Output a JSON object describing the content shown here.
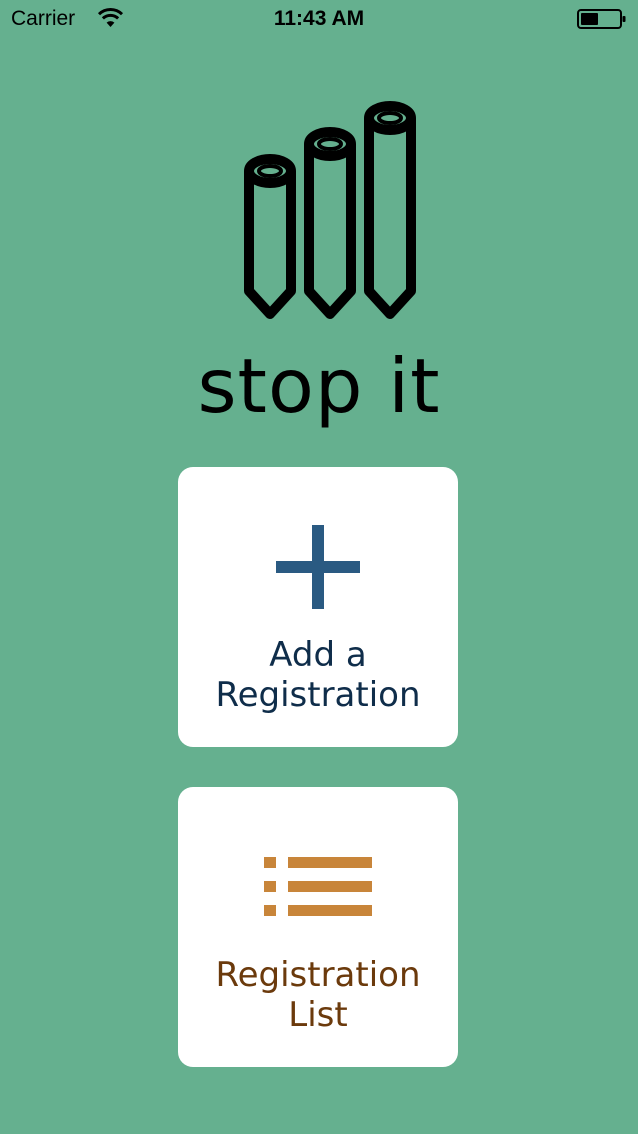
{
  "status_bar": {
    "carrier": "Carrier",
    "time": "11:43 AM",
    "wifi_icon": "wifi-icon",
    "battery_icon": "battery-icon"
  },
  "app": {
    "title": "stop it",
    "logo_icon": "pencils-logo-icon"
  },
  "tiles": [
    {
      "icon": "plus-icon",
      "label_line1": "Add a",
      "label_line2": "Registration",
      "color": "#2a5a82"
    },
    {
      "icon": "list-icon",
      "label_line1": "Registration",
      "label_line2": "List",
      "color": "#c8853a"
    }
  ],
  "colors": {
    "background": "#65b08f",
    "tile_background": "#ffffff",
    "add_label": "#0f2d4a",
    "list_label": "#6b3a0c"
  }
}
